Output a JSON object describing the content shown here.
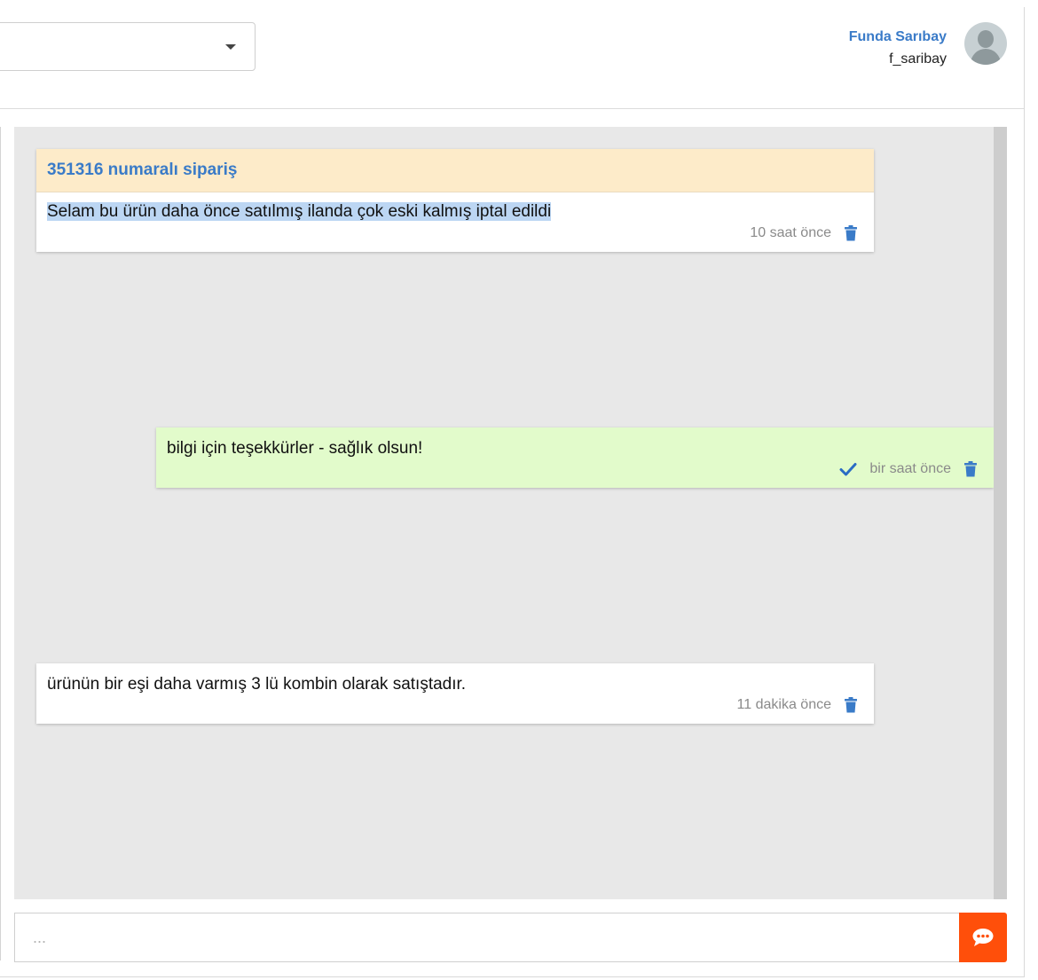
{
  "user": {
    "name": "Funda Sarıbay",
    "handle": "f_saribay"
  },
  "dropdown": {
    "value": ""
  },
  "messages": [
    {
      "order_title": "351316 numaralı sipariş",
      "text": "Selam bu ürün daha önce satılmış ilanda çok eski kalmış iptal edildi",
      "time": "10 saat önce",
      "direction": "incoming"
    },
    {
      "text": "bilgi için teşekkürler - sağlık olsun!",
      "time": "bir saat önce",
      "direction": "outgoing",
      "read": true
    },
    {
      "text": "ürünün bir eşi daha varmış 3 lü kombin olarak satıştadır.",
      "time": "11 dakika önce",
      "direction": "incoming"
    }
  ],
  "composer": {
    "placeholder": "..."
  },
  "icons": {
    "delete": "trash-icon",
    "read": "check-icon",
    "send": "chat-bubble-icon",
    "caret": "caret-down-icon"
  },
  "colors": {
    "accent": "#3a7bc8",
    "send": "#ff4f0a",
    "outgoing_bg": "#e2fbcb",
    "order_bg": "#fdebc9"
  }
}
